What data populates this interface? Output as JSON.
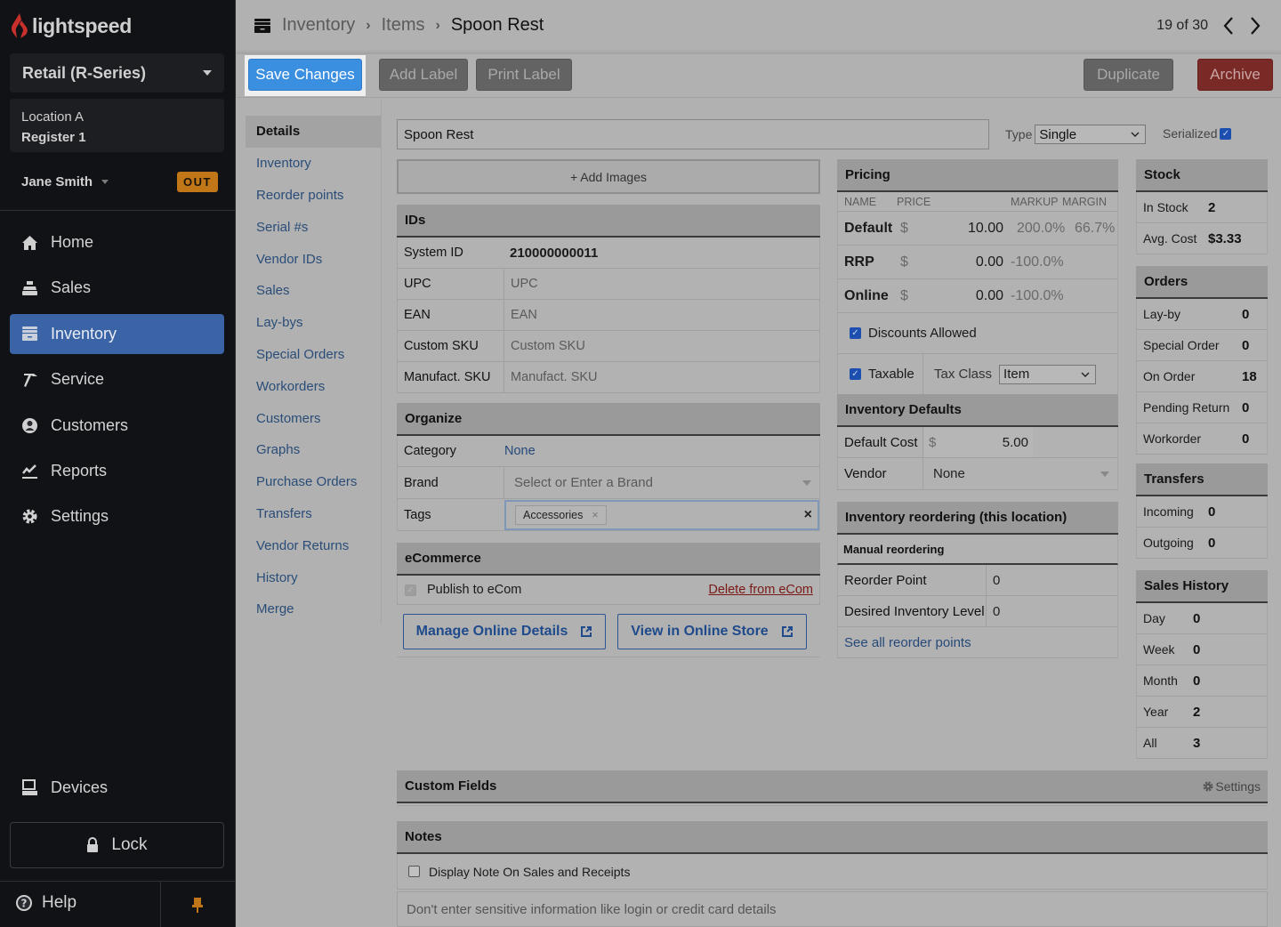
{
  "app": {
    "brand": "lightspeed",
    "product_selector": "Retail (R-Series)",
    "location": "Location A",
    "register": "Register 1",
    "user": "Jane Smith",
    "clock_status": "OUT"
  },
  "nav": {
    "items": [
      {
        "label": "Home",
        "icon": "home-icon"
      },
      {
        "label": "Sales",
        "icon": "register-icon"
      },
      {
        "label": "Inventory",
        "icon": "inventory-icon",
        "active": true
      },
      {
        "label": "Service",
        "icon": "hammer-icon"
      },
      {
        "label": "Customers",
        "icon": "user-circle-icon"
      },
      {
        "label": "Reports",
        "icon": "chart-icon"
      },
      {
        "label": "Settings",
        "icon": "gear-icon"
      }
    ],
    "devices": "Devices",
    "lock": "Lock",
    "help": "Help"
  },
  "header": {
    "breadcrumb": [
      "Inventory",
      "Items",
      "Spoon Rest"
    ],
    "pager": "19 of 30"
  },
  "toolbar": {
    "save": "Save Changes",
    "add_label": "Add Label",
    "print_label": "Print Label",
    "duplicate": "Duplicate",
    "archive": "Archive"
  },
  "subnav": {
    "items": [
      "Details",
      "Inventory",
      "Reorder points",
      "Serial #s",
      "Vendor IDs",
      "Sales",
      "Lay-bys",
      "Special Orders",
      "Workorders",
      "Customers",
      "Graphs",
      "Purchase Orders",
      "Transfers",
      "Vendor Returns",
      "History",
      "Merge"
    ]
  },
  "item": {
    "name": "Spoon Rest",
    "type_label": "Type",
    "type_value": "Single",
    "serialized_label": "Serialized",
    "serialized": true,
    "add_images": "+ Add Images"
  },
  "ids": {
    "title": "IDs",
    "system_id_label": "System ID",
    "system_id": "210000000011",
    "rows": [
      {
        "label": "UPC",
        "placeholder": "UPC"
      },
      {
        "label": "EAN",
        "placeholder": "EAN"
      },
      {
        "label": "Custom SKU",
        "placeholder": "Custom SKU"
      },
      {
        "label": "Manufact. SKU",
        "placeholder": "Manufact. SKU"
      }
    ]
  },
  "organize": {
    "title": "Organize",
    "category_label": "Category",
    "category_value": "None",
    "brand_label": "Brand",
    "brand_placeholder": "Select or Enter a Brand",
    "tags_label": "Tags",
    "tags": [
      "Accessories"
    ]
  },
  "ecommerce": {
    "title": "eCommerce",
    "publish_label": "Publish to eCom",
    "delete_link": "Delete from eCom",
    "manage_btn": "Manage Online Details",
    "view_btn": "View in Online Store"
  },
  "pricing": {
    "title": "Pricing",
    "columns": [
      "NAME",
      "PRICE",
      "MARKUP",
      "MARGIN"
    ],
    "rows": [
      {
        "name": "Default",
        "currency": "$",
        "price": "10.00",
        "markup": "200.0%",
        "margin": "66.7%"
      },
      {
        "name": "RRP",
        "currency": "$",
        "price": "0.00",
        "markup": "-100.0%",
        "margin": ""
      },
      {
        "name": "Online",
        "currency": "$",
        "price": "0.00",
        "markup": "-100.0%",
        "margin": ""
      }
    ],
    "discounts_label": "Discounts Allowed",
    "discounts_allowed": true,
    "taxable_label": "Taxable",
    "taxable": true,
    "tax_class_label": "Tax Class",
    "tax_class": "Item"
  },
  "inventory_defaults": {
    "title": "Inventory Defaults",
    "cost_label": "Default Cost",
    "currency": "$",
    "cost": "5.00",
    "vendor_label": "Vendor",
    "vendor": "None"
  },
  "reordering": {
    "title": "Inventory reordering (this location)",
    "subtitle": "Manual reordering",
    "reorder_point_label": "Reorder Point",
    "reorder_point": "0",
    "desired_level_label": "Desired Inventory Level",
    "desired_level": "0",
    "see_all": "See all reorder points"
  },
  "stock": {
    "title": "Stock",
    "rows": [
      {
        "label": "In Stock",
        "value": "2"
      },
      {
        "label": "Avg. Cost",
        "value": "$3.33"
      }
    ]
  },
  "orders": {
    "title": "Orders",
    "rows": [
      {
        "label": "Lay-by",
        "value": "0"
      },
      {
        "label": "Special Order",
        "value": "0"
      },
      {
        "label": "On Order",
        "value": "18"
      },
      {
        "label": "Pending Return",
        "value": "0"
      },
      {
        "label": "Workorder",
        "value": "0"
      }
    ]
  },
  "transfers": {
    "title": "Transfers",
    "rows": [
      {
        "label": "Incoming",
        "value": "0"
      },
      {
        "label": "Outgoing",
        "value": "0"
      }
    ]
  },
  "sales_history": {
    "title": "Sales History",
    "rows": [
      {
        "label": "Day",
        "value": "0"
      },
      {
        "label": "Week",
        "value": "0"
      },
      {
        "label": "Month",
        "value": "0"
      },
      {
        "label": "Year",
        "value": "2"
      },
      {
        "label": "All",
        "value": "3"
      }
    ]
  },
  "custom_fields": {
    "title": "Custom Fields",
    "settings": "Settings"
  },
  "notes": {
    "title": "Notes",
    "display_label": "Display Note On Sales and Receipts",
    "display": false,
    "placeholder": "Don't enter sensitive information like login or credit card details"
  },
  "colors": {
    "accent": "#3b8fe0",
    "archive": "#7a2a26",
    "out_badge": "#c17718",
    "nav_active": "#3a64a6"
  }
}
